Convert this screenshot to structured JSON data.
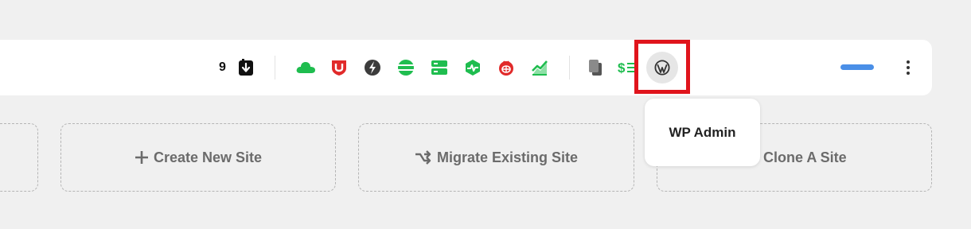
{
  "toolbar": {
    "download_count": "9",
    "icons": [
      "download-icon",
      "cloud-icon",
      "shield-icon",
      "bolt-icon",
      "globe-icon",
      "server-icon",
      "pulse-icon",
      "bug-icon",
      "chart-icon",
      "copy-icon",
      "dollar-list-icon",
      "wordpress-icon",
      "more-icon"
    ],
    "brand_color": "#1fbd4f",
    "highlight_color": "#e0141c",
    "accent_color": "#4a8fe7"
  },
  "tooltip": {
    "text": "WP Admin"
  },
  "actions": {
    "create_new_site": "Create New Site",
    "migrate_existing_site": "Migrate Existing Site",
    "clone_a_site": "Clone A Site"
  }
}
